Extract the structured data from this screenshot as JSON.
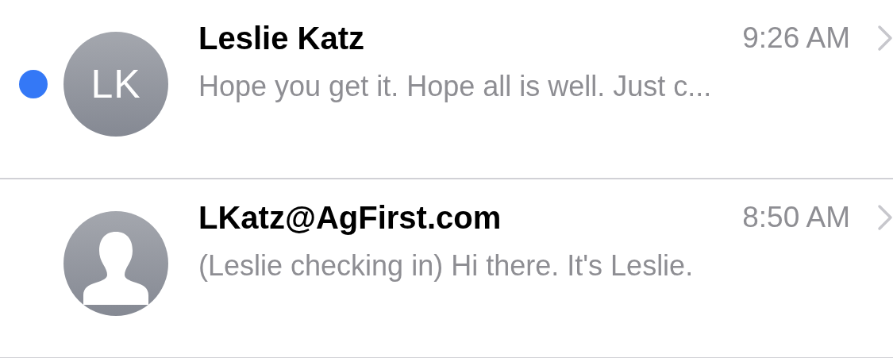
{
  "messages": [
    {
      "sender": "Leslie Katz",
      "time": "9:26 AM",
      "preview": "Hope you get it. Hope all is well. Just c...",
      "unread": true,
      "avatar": {
        "kind": "initials",
        "initials": "LK"
      }
    },
    {
      "sender": "LKatz@AgFirst.com",
      "time": "8:50 AM",
      "preview": "(Leslie checking in) Hi there. It's Leslie.",
      "unread": false,
      "avatar": {
        "kind": "silhouette"
      }
    }
  ]
}
